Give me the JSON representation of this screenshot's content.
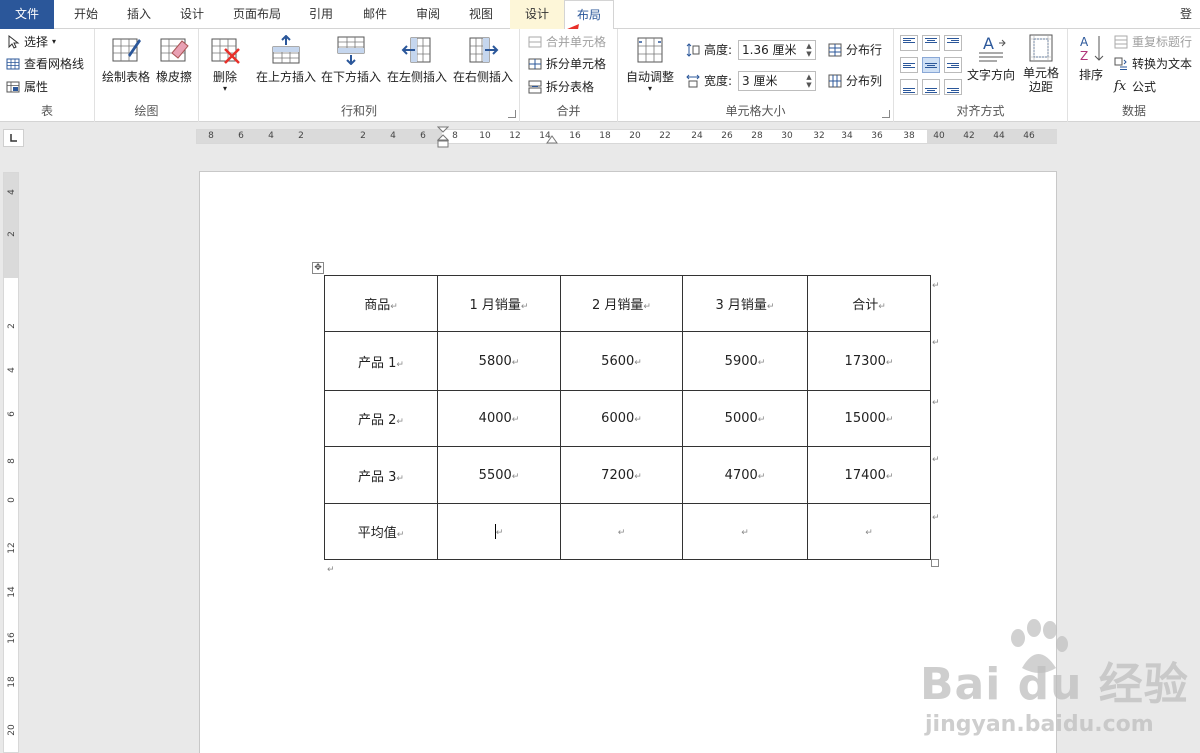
{
  "tabs": {
    "file": "文件",
    "home": "开始",
    "insert": "插入",
    "design": "设计",
    "layout_page": "页面布局",
    "references": "引用",
    "mailings": "邮件",
    "review": "审阅",
    "view": "视图",
    "ctx_design": "设计",
    "ctx_layout": "布局",
    "login": "登"
  },
  "ribbon": {
    "table_group": {
      "label": "表",
      "select": "选择",
      "view_gridlines": "查看网格线",
      "properties": "属性"
    },
    "draw_group": {
      "label": "绘图",
      "draw_table": "绘制表格",
      "eraser": "橡皮擦"
    },
    "rows_cols_group": {
      "label": "行和列",
      "delete": "删除",
      "insert_above": "在上方插入",
      "insert_below": "在下方插入",
      "insert_left": "在左侧插入",
      "insert_right": "在右侧插入"
    },
    "merge_group": {
      "label": "合并",
      "merge_cells": "合并单元格",
      "split_cells": "拆分单元格",
      "split_table": "拆分表格"
    },
    "cell_size_group": {
      "label": "单元格大小",
      "autofit": "自动调整",
      "height_label": "高度:",
      "height_value": "1.36 厘米",
      "width_label": "宽度:",
      "width_value": "3 厘米",
      "distribute_rows": "分布行",
      "distribute_cols": "分布列"
    },
    "alignment_group": {
      "label": "对齐方式",
      "text_direction": "文字方向",
      "cell_margins_1": "单元格",
      "cell_margins_2": "边距"
    },
    "data_group": {
      "label": "数据",
      "sort": "排序",
      "repeat_header": "重复标题行",
      "convert_to_text": "转换为文本",
      "formula": "公式"
    }
  },
  "hruler": [
    "8",
    "6",
    "4",
    "2",
    "2",
    "4",
    "6",
    "8",
    "10",
    "12",
    "14",
    "16",
    "18",
    "20",
    "22",
    "24",
    "26",
    "28",
    "30",
    "32",
    "34",
    "36",
    "38",
    "40",
    "42",
    "44",
    "46"
  ],
  "vruler": [
    "4",
    "2",
    "2",
    "4",
    "6",
    "8",
    "0",
    "12",
    "14",
    "16",
    "18",
    "20"
  ],
  "table": {
    "rows": [
      [
        "商品",
        "1 月销量",
        "2 月销量",
        "3 月销量",
        "合计"
      ],
      [
        "产品 1",
        "5800",
        "5600",
        "5900",
        "17300"
      ],
      [
        "产品 2",
        "4000",
        "6000",
        "5000",
        "15000"
      ],
      [
        "产品 3",
        "5500",
        "7200",
        "4700",
        "17400"
      ],
      [
        "平均值",
        "",
        "",
        "",
        ""
      ]
    ]
  },
  "colors": {
    "file_tab": "#2b579a",
    "context_tab_bg": "#fdf6d8",
    "arrow": "#e8302a"
  },
  "watermark": {
    "brand": "Bai du 经验",
    "url": "jingyan.baidu.com"
  }
}
